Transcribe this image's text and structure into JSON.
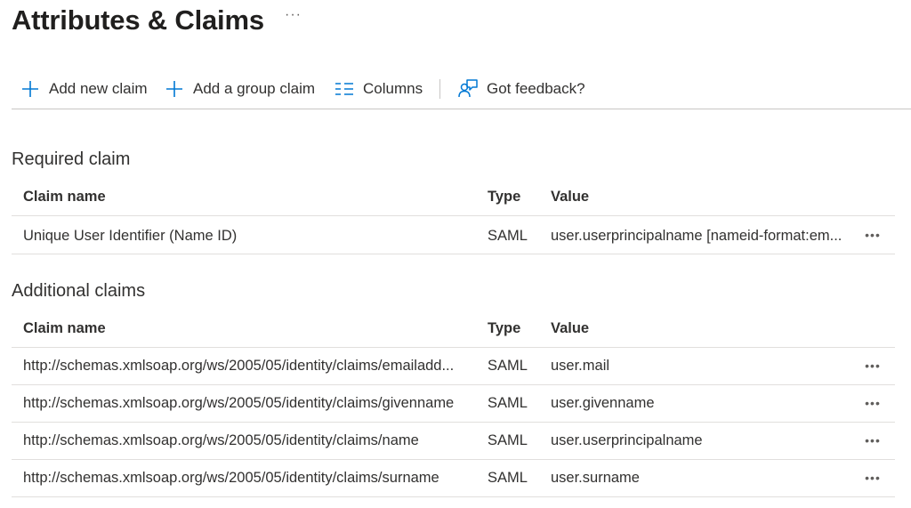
{
  "page": {
    "title": "Attributes & Claims",
    "more": "···"
  },
  "toolbar": {
    "add_claim": "Add new claim",
    "add_group_claim": "Add a group claim",
    "columns": "Columns",
    "feedback": "Got feedback?"
  },
  "required": {
    "title": "Required claim",
    "headers": {
      "name": "Claim name",
      "type": "Type",
      "value": "Value"
    },
    "rows": [
      {
        "name": "Unique User Identifier (Name ID)",
        "type": "SAML",
        "value": "user.userprincipalname [nameid-format:em...",
        "more": "•••"
      }
    ]
  },
  "additional": {
    "title": "Additional claims",
    "headers": {
      "name": "Claim name",
      "type": "Type",
      "value": "Value"
    },
    "rows": [
      {
        "name": "http://schemas.xmlsoap.org/ws/2005/05/identity/claims/emailadd...",
        "type": "SAML",
        "value": "user.mail",
        "more": "•••"
      },
      {
        "name": "http://schemas.xmlsoap.org/ws/2005/05/identity/claims/givenname",
        "type": "SAML",
        "value": "user.givenname",
        "more": "•••"
      },
      {
        "name": "http://schemas.xmlsoap.org/ws/2005/05/identity/claims/name",
        "type": "SAML",
        "value": "user.userprincipalname",
        "more": "•••"
      },
      {
        "name": "http://schemas.xmlsoap.org/ws/2005/05/identity/claims/surname",
        "type": "SAML",
        "value": "user.surname",
        "more": "•••"
      }
    ]
  },
  "icons": {
    "add": "plus-icon",
    "columns": "columns-icon",
    "feedback": "feedback-icon",
    "more": "more-icon"
  },
  "colors": {
    "accent": "#0078d4",
    "text": "#323130",
    "divider": "#e1dfdd"
  }
}
